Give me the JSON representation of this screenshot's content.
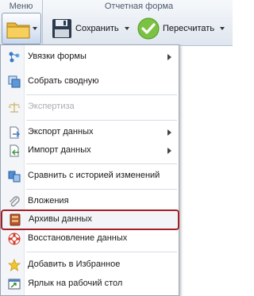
{
  "ribbon": {
    "menu_group_title": "Меню",
    "form_group_title": "Отчетная форма",
    "save_label": "Сохранить",
    "recalc_label": "Пересчитать"
  },
  "menu": {
    "items": [
      {
        "label": "Увязки формы",
        "icon": "links-icon",
        "submenu": true,
        "disabled": false
      },
      {
        "label": "Собрать сводную",
        "icon": "collect-icon",
        "submenu": false,
        "disabled": false
      },
      {
        "label": "Экспертиза",
        "icon": "scales-icon",
        "submenu": false,
        "disabled": true
      },
      {
        "label": "Экспорт данных",
        "icon": "export-icon",
        "submenu": true,
        "disabled": false
      },
      {
        "label": "Импорт данных",
        "icon": "import-icon",
        "submenu": true,
        "disabled": false
      },
      {
        "label": "Сравнить с историей изменений",
        "icon": "compare-icon",
        "submenu": false,
        "disabled": false
      },
      {
        "label": "Вложения",
        "icon": "paperclip-icon",
        "submenu": false,
        "disabled": false
      },
      {
        "label": "Архивы данных",
        "icon": "archive-icon",
        "submenu": false,
        "disabled": false,
        "highlighted": true
      },
      {
        "label": "Восстановление данных",
        "icon": "lifebuoy-icon",
        "submenu": false,
        "disabled": false
      },
      {
        "label": "Добавить в Избранное",
        "icon": "star-icon",
        "submenu": false,
        "disabled": false
      },
      {
        "label": "Ярлык на рабочий стол",
        "icon": "shortcut-icon",
        "submenu": false,
        "disabled": false
      }
    ]
  },
  "colors": {
    "highlight_border": "#a31f26",
    "disabled_text": "#a9adb3"
  }
}
